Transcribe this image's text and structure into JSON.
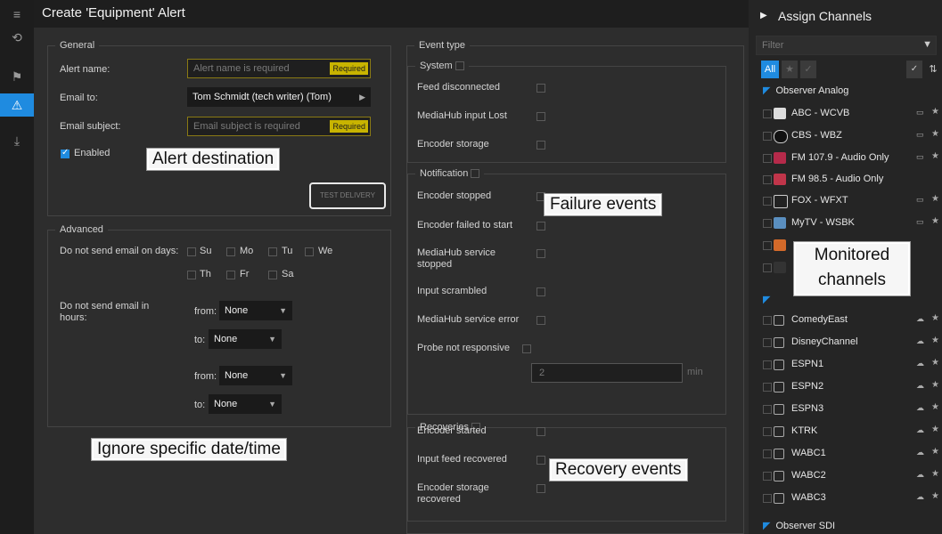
{
  "title": "Create 'Equipment' Alert",
  "general": {
    "legend": "General",
    "alert_name_label": "Alert name:",
    "alert_name_placeholder": "Alert name is required",
    "alert_name_tag": "Required",
    "email_to_label": "Email to:",
    "email_to_value": "Tom Schmidt (tech writer) (Tom)",
    "email_subject_label": "Email subject:",
    "email_subject_placeholder": "Email subject is required",
    "email_subject_tag": "Required",
    "enabled_label": "Enabled",
    "enabled": true,
    "test_delivery": "TEST DELIVERY"
  },
  "advanced": {
    "legend": "Advanced",
    "days_label": "Do not send email on days:",
    "days": [
      "Su",
      "Mo",
      "Tu",
      "We",
      "Th",
      "Fr",
      "Sa"
    ],
    "hours_label": "Do not send email in hours:",
    "from_label": "from:",
    "to_label": "to:",
    "none": "None"
  },
  "event_type": {
    "legend": "Event type",
    "system_legend": "System",
    "system_items": [
      "Feed disconnected",
      "MediaHub input Lost",
      "Encoder storage"
    ],
    "notification_legend": "Notification",
    "notification_items": [
      "Encoder stopped",
      "Encoder failed to start",
      "MediaHub service stopped",
      "Input scrambled",
      "MediaHub service error",
      "Probe not responsive"
    ],
    "probe_value": "2",
    "probe_unit": "min",
    "recoveries_legend": "Recoveries",
    "recoveries_items": [
      "Encoder started",
      "Input feed recovered",
      "Encoder storage recovered"
    ]
  },
  "callouts": {
    "alert_destination": "Alert destination",
    "failure_events": "Failure events",
    "monitored_channels": "Monitored channels",
    "ignore": "Ignore specific date/time",
    "recovery_events": "Recovery events"
  },
  "channels": {
    "title": "Assign Channels",
    "filter_placeholder": "Filter",
    "all_label": "All",
    "group1": "Observer Analog",
    "group2": "Observer SDI",
    "analog": [
      "ABC - WCVB",
      "CBS - WBZ",
      "FM 107.9 - Audio Only",
      "FM 98.5 - Audio Only",
      "FOX - WFXT",
      "MyTV - WSBK"
    ],
    "cloud": [
      "ComedyEast",
      "DisneyChannel",
      "ESPN1",
      "ESPN2",
      "ESPN3",
      "KTRK",
      "WABC1",
      "WABC2",
      "WABC3"
    ]
  }
}
